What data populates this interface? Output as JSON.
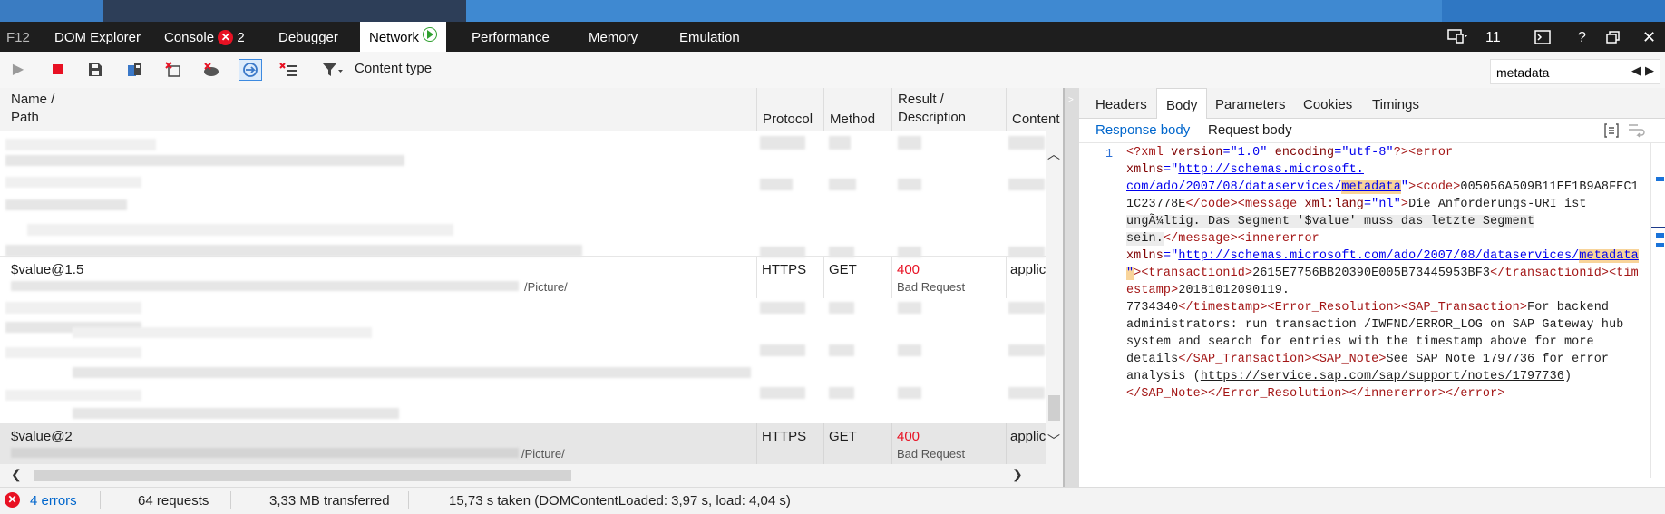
{
  "tabs": {
    "f12": "F12",
    "dom": "DOM Explorer",
    "console": "Console",
    "console_errors": "2",
    "debugger": "Debugger",
    "network": "Network",
    "performance": "Performance",
    "memory": "Memory",
    "emulation": "Emulation",
    "target_count": "11"
  },
  "toolbar": {
    "content_type_label": "Content type",
    "search_value": "metadata"
  },
  "grid": {
    "columns": {
      "name": "Name /",
      "path": "Path",
      "protocol": "Protocol",
      "method": "Method",
      "result": "Result /",
      "description": "Description",
      "content": "Content"
    },
    "rows": [
      {
        "name": "$value@1.5",
        "path_suffix": "/Picture/",
        "protocol": "HTTPS",
        "method": "GET",
        "status": "400",
        "status_text": "Bad Request",
        "content": "applic"
      },
      {
        "name": "$value@2",
        "path_suffix": "/Picture/",
        "protocol": "HTTPS",
        "method": "GET",
        "status": "400",
        "status_text": "Bad Request",
        "content": "applic"
      }
    ]
  },
  "details": {
    "tabs": [
      "Headers",
      "Body",
      "Parameters",
      "Cookies",
      "Timings"
    ],
    "subtabs": [
      "Response body",
      "Request body"
    ],
    "line_number": "1",
    "body": {
      "l1a": "<?xml ",
      "l1b": "version",
      "l1c": "=\"1.0\" ",
      "l1d": "encoding",
      "l1e": "=\"utf-8\"",
      "l1f": "?><error",
      "l2a": "xmlns",
      "l2b": "=\"",
      "l2c": "http://schemas.microsoft.",
      "l3a": "com/ado/2007/08/dataservices/",
      "l3b": "metadata",
      "l3c": "\"",
      "l3d": "><code>",
      "l3e": "005056A509B11EE1B9A8FEC1",
      "l4a": "1C23778E",
      "l4b": "</code><message ",
      "l4c": "xml:lang",
      "l4d": "=\"nl\"",
      "l4e": ">",
      "l4f": "Die Anforderungs-URI ist",
      "l5": "ungÃ¼ltig. Das Segment '$value' muss das letzte Segment",
      "l6a": "sein.",
      "l6b": "</message><innererror",
      "l7a": "xmlns",
      "l7b": "=\"",
      "l7c": "http://schemas.microsoft.com/ado/2007/08/dataservices/",
      "l7d": "metadata",
      "l8a": "\"",
      "l8b": "><transactionid>",
      "l8c": "2615E7756BB20390E005B73445953BF3",
      "l8d": "</transactionid><tim",
      "l9a": "estamp>",
      "l9b": "20181012090119.",
      "l10a": "7734340",
      "l10b": "</timestamp><Error_Resolution><SAP_Transaction>",
      "l10c": "For backend",
      "l11": "administrators: run transaction /IWFND/ERROR_LOG on SAP Gateway hub",
      "l12": "system and search for entries with the timestamp above for more",
      "l13a": "details",
      "l13b": "</SAP_Transaction><SAP_Note>",
      "l13c": "See SAP Note 1797736 for error",
      "l14a": "analysis (",
      "l14b": "https://service.sap.com/sap/support/notes/1797736",
      "l14c": ")",
      "l15": "</SAP_Note></Error_Resolution></innererror></error>"
    }
  },
  "status": {
    "errors": "4 errors",
    "requests": "64 requests",
    "transferred": "3,33 MB transferred",
    "timing": "15,73 s taken (DOMContentLoaded: 3,97 s, load: 4,04 s)"
  },
  "colors": {
    "error_red": "#e81123",
    "link_blue": "#0066cc",
    "tab_bar_bg": "#1e1e1e",
    "highlight": "#f8d49a"
  },
  "icons": [
    "play-icon",
    "stop-icon",
    "save-icon",
    "clear-on-navigate-icon",
    "clear-entries-icon",
    "clear-cache-icon",
    "always-refresh-icon",
    "clear-cookies-icon",
    "filter-icon",
    "prev-match-icon",
    "next-match-icon",
    "screen-target-icon",
    "console-toggle-icon",
    "help-icon",
    "undock-icon",
    "close-icon"
  ]
}
